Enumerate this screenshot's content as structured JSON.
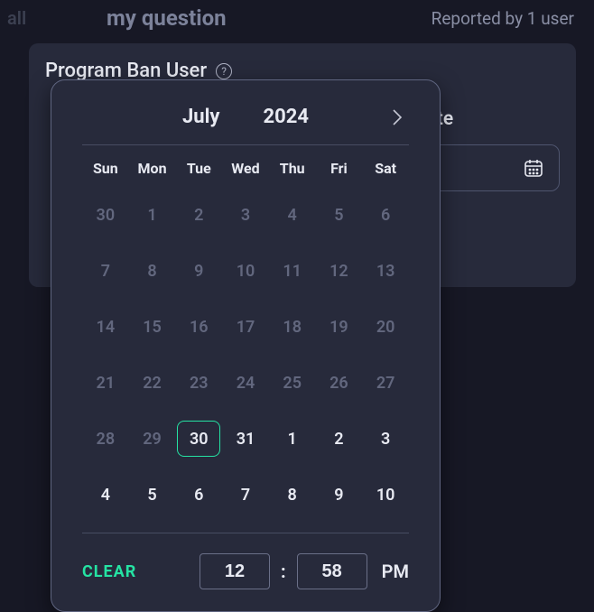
{
  "header": {
    "left_fragment": "all",
    "title": "my question",
    "reported": "Reported by 1 user"
  },
  "card": {
    "title": "Program Ban User",
    "section_label_fragment": "piry date"
  },
  "datepicker": {
    "month": "July",
    "year": "2024",
    "dows": [
      "Sun",
      "Mon",
      "Tue",
      "Wed",
      "Thu",
      "Fri",
      "Sat"
    ],
    "days": [
      {
        "n": "30",
        "dim": true
      },
      {
        "n": "1",
        "dim": true
      },
      {
        "n": "2",
        "dim": true
      },
      {
        "n": "3",
        "dim": true
      },
      {
        "n": "4",
        "dim": true
      },
      {
        "n": "5",
        "dim": true
      },
      {
        "n": "6",
        "dim": true
      },
      {
        "n": "7",
        "dim": true
      },
      {
        "n": "8",
        "dim": true
      },
      {
        "n": "9",
        "dim": true
      },
      {
        "n": "10",
        "dim": true
      },
      {
        "n": "11",
        "dim": true
      },
      {
        "n": "12",
        "dim": true
      },
      {
        "n": "13",
        "dim": true
      },
      {
        "n": "14",
        "dim": true
      },
      {
        "n": "15",
        "dim": true
      },
      {
        "n": "16",
        "dim": true
      },
      {
        "n": "17",
        "dim": true
      },
      {
        "n": "18",
        "dim": true
      },
      {
        "n": "19",
        "dim": true
      },
      {
        "n": "20",
        "dim": true
      },
      {
        "n": "21",
        "dim": true
      },
      {
        "n": "22",
        "dim": true
      },
      {
        "n": "23",
        "dim": true
      },
      {
        "n": "24",
        "dim": true
      },
      {
        "n": "25",
        "dim": true
      },
      {
        "n": "26",
        "dim": true
      },
      {
        "n": "27",
        "dim": true
      },
      {
        "n": "28",
        "dim": true
      },
      {
        "n": "29",
        "dim": true
      },
      {
        "n": "30",
        "dim": false,
        "today": true
      },
      {
        "n": "31",
        "dim": false
      },
      {
        "n": "1",
        "dim": false
      },
      {
        "n": "2",
        "dim": false
      },
      {
        "n": "3",
        "dim": false
      },
      {
        "n": "4",
        "dim": false
      },
      {
        "n": "5",
        "dim": false
      },
      {
        "n": "6",
        "dim": false
      },
      {
        "n": "7",
        "dim": false
      },
      {
        "n": "8",
        "dim": false
      },
      {
        "n": "9",
        "dim": false
      },
      {
        "n": "10",
        "dim": false
      }
    ],
    "clear_label": "CLEAR",
    "hour": "12",
    "minute": "58",
    "ampm": "PM"
  }
}
